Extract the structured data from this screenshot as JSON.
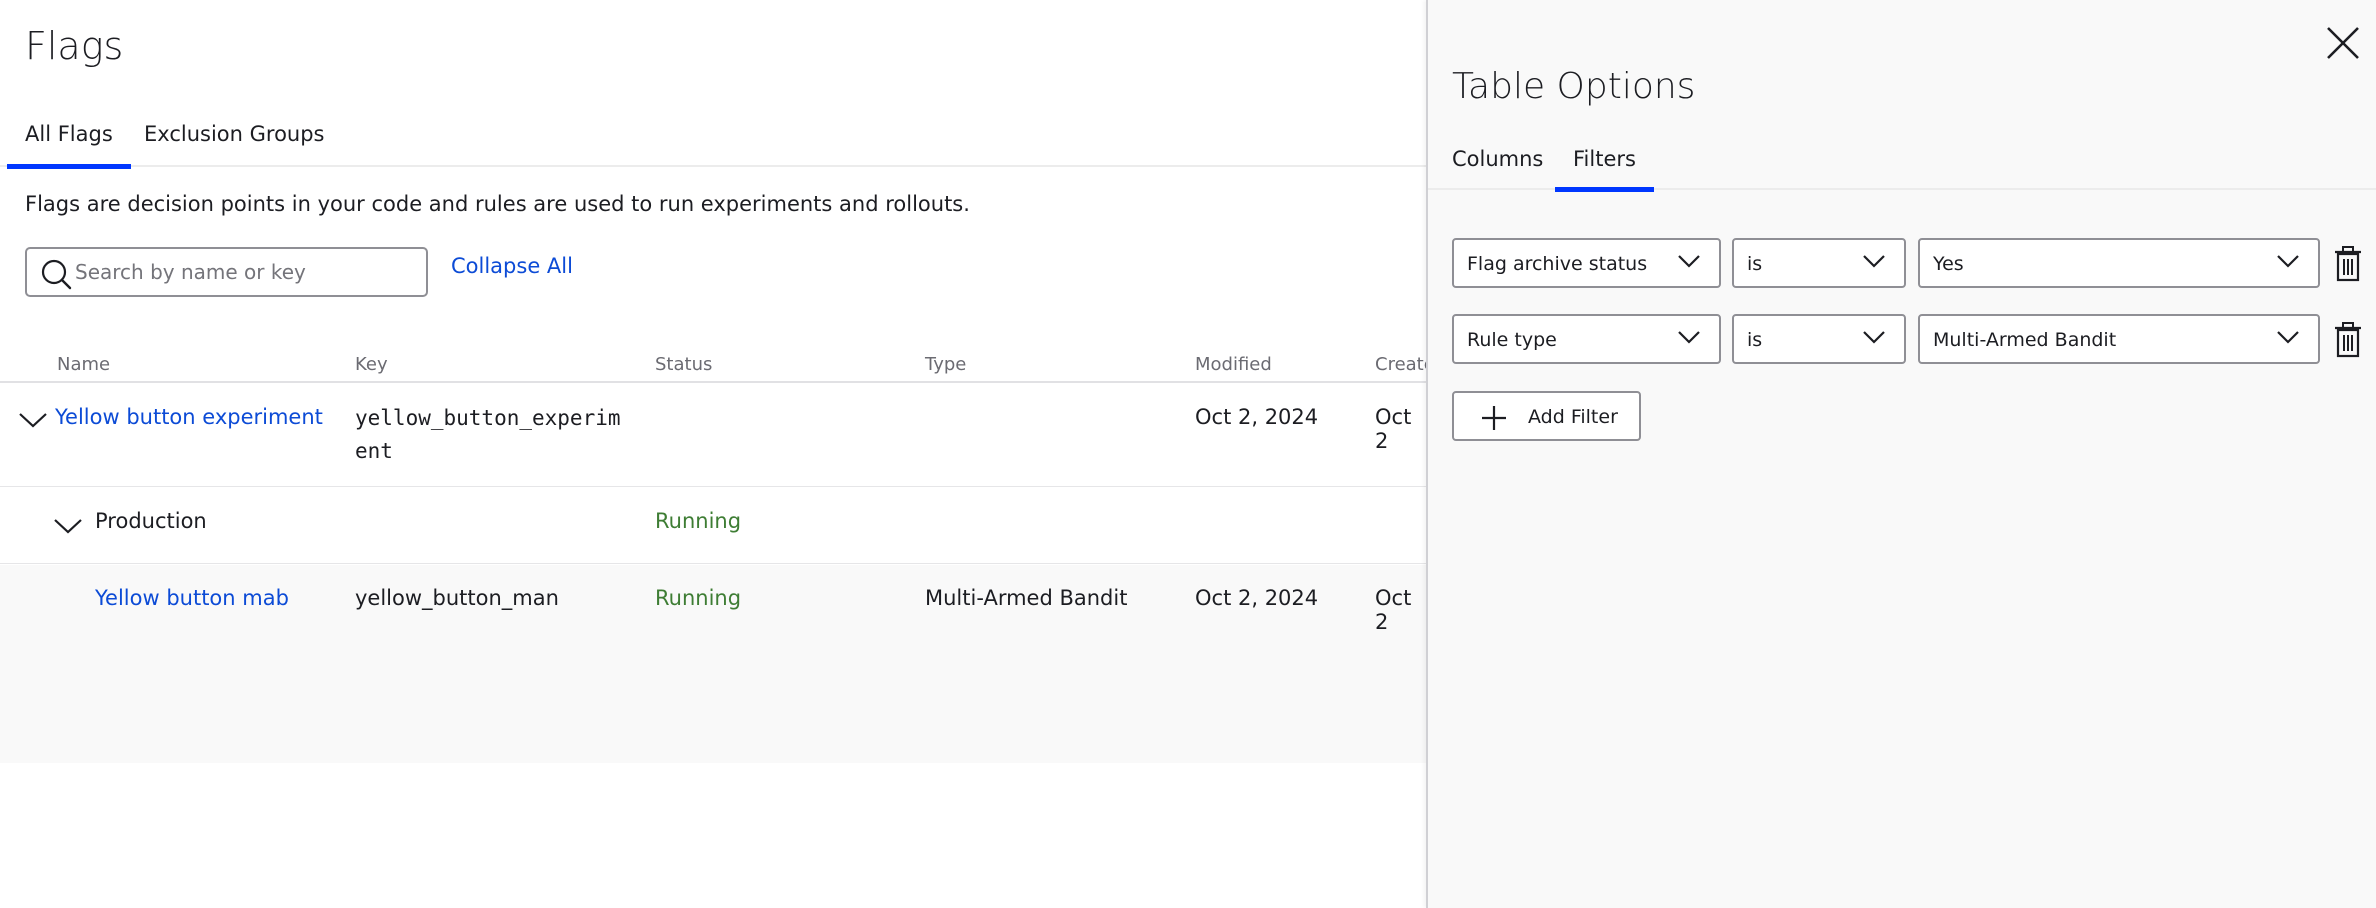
{
  "page": {
    "title": "Flags",
    "tabs": [
      {
        "label": "All Flags",
        "active": true
      },
      {
        "label": "Exclusion Groups",
        "active": false
      }
    ],
    "description": "Flags are decision points in your code and rules are used to run experiments and rollouts.",
    "search": {
      "placeholder": "Search by name or key",
      "value": ""
    },
    "collapse_all_label": "Collapse All"
  },
  "table": {
    "columns": [
      "Name",
      "Key",
      "Status",
      "Type",
      "Modified",
      "Create"
    ],
    "rows": [
      {
        "kind": "flag",
        "name": "Yellow button experiment",
        "key_line1": "yellow_button_experim",
        "key_line2": "ent",
        "status": "",
        "type": "",
        "modified": "Oct 2, 2024",
        "created": "Oct 2"
      },
      {
        "kind": "environment",
        "name": "Production",
        "status": "Running"
      },
      {
        "kind": "rule",
        "name": "Yellow button mab",
        "key": "yellow_button_man",
        "status": "Running",
        "type": "Multi-Armed Bandit",
        "modified": "Oct 2, 2024",
        "created": "Oct 2"
      }
    ]
  },
  "panel": {
    "title": "Table Options",
    "tabs": [
      {
        "label": "Columns",
        "active": false
      },
      {
        "label": "Filters",
        "active": true
      }
    ],
    "filters": [
      {
        "field": "Flag archive status",
        "operator": "is",
        "value": "Yes"
      },
      {
        "field": "Rule type",
        "operator": "is",
        "value": "Multi-Armed Bandit"
      }
    ],
    "add_filter_label": "Add Filter"
  },
  "colors": {
    "accent": "#0037ff",
    "link": "#0c4bd6",
    "running": "#3e7d34",
    "panel_bg": "#f9f9f9"
  },
  "icons": [
    "search-icon",
    "chevron-down-icon",
    "trash-icon",
    "close-icon",
    "plus-icon"
  ]
}
